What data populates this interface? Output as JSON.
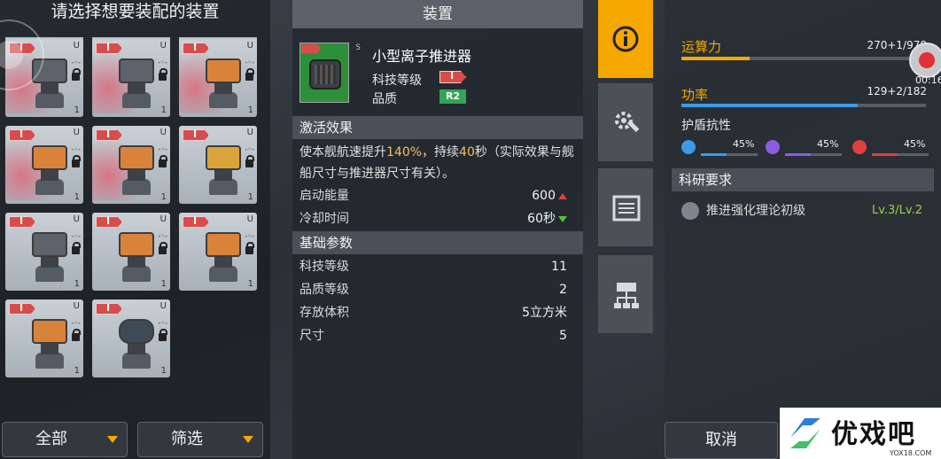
{
  "left": {
    "title": "请选择想要装配的装置",
    "cards": [
      {
        "variant": "dark red"
      },
      {
        "variant": "dark red"
      },
      {
        "variant": "orange red"
      },
      {
        "variant": "orange red"
      },
      {
        "variant": "orange red"
      },
      {
        "variant": "yellow"
      },
      {
        "variant": "dark"
      },
      {
        "variant": "orange"
      },
      {
        "variant": "orange"
      },
      {
        "variant": "orange"
      },
      {
        "variant": "blue"
      }
    ],
    "card_u": "U",
    "card_count": "1",
    "filter_all": "全部",
    "filter_select": "筛选"
  },
  "center": {
    "header": "装置",
    "item_name": "小型离子推进器",
    "item_slot": "S",
    "tech_label": "科技等级",
    "quality_label": "品质",
    "quality_value": "R2",
    "section_activation": "激活效果",
    "desc_pre": "使本舰航速提升",
    "desc_pct": "140%",
    "desc_mid": "，持续",
    "desc_sec": "40",
    "desc_post": "秒（实际效果与舰船尺寸与推进器尺寸有关）。",
    "energy_label": "启动能量",
    "energy_value": "600",
    "cooldown_label": "冷却时间",
    "cooldown_value": "60秒",
    "section_base": "基础参数",
    "params": [
      {
        "label": "科技等级",
        "value": "11"
      },
      {
        "label": "品质等级",
        "value": "2"
      },
      {
        "label": "存放体积",
        "value": "5立方米"
      },
      {
        "label": "尺寸",
        "value": "5"
      }
    ]
  },
  "tabs": [
    "info-icon",
    "gear-wrench-icon",
    "list-icon",
    "schematic-icon"
  ],
  "right": {
    "compute_label": "运算力",
    "compute_value": "270+1/978",
    "compute_fraction": 0.28,
    "power_label": "功率",
    "power_value": "129+2/182",
    "power_fraction": 0.72,
    "shield_title": "护盾抗性",
    "resist": [
      {
        "name": "lightning",
        "value": "45%",
        "color": "#3b9be8"
      },
      {
        "name": "energy",
        "value": "45%",
        "color": "#8c5ce0"
      },
      {
        "name": "fire",
        "value": "45%",
        "color": "#e04040"
      }
    ],
    "req_head": "科研要求",
    "req_name": "推进强化理论初级",
    "req_level": "Lv.3/Lv.2",
    "cancel": "取消",
    "timer": "00:16"
  },
  "watermark": {
    "text": "优戏吧",
    "url": "YOX18.COM"
  }
}
